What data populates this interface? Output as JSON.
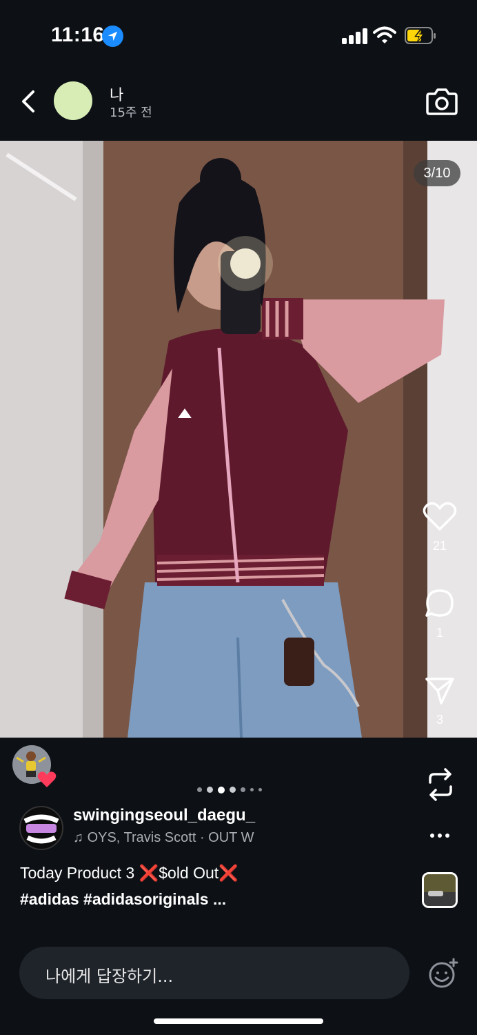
{
  "status_bar": {
    "time": "11:16",
    "icons": [
      "location-icon",
      "cellular-signal-icon",
      "wifi-icon",
      "battery-charging-icon"
    ]
  },
  "header": {
    "username": "나",
    "posted_ago": "15주 전",
    "back_icon": "chevron-left-icon",
    "camera_icon": "camera-icon"
  },
  "post": {
    "counter": "3/10",
    "likes": "21",
    "comments": "1",
    "shares": "3",
    "carousel_total": 7,
    "carousel_active": 3
  },
  "account": {
    "name": "swingingseoul_daegu_",
    "music": "OYS, Travis Scott · OUT W"
  },
  "caption": {
    "line1": "Today Product 3 ❌$old Out❌",
    "line2": "#adidas #adidasoriginals ..."
  },
  "reply": {
    "placeholder": "나에게 답장하기..."
  },
  "colors": {
    "background": "#0d1116",
    "reply_bar": "#1f242b",
    "heart_badge": "#ff3b5c",
    "location_badge": "#1a8cff",
    "battery_charge": "#ffd60a"
  }
}
